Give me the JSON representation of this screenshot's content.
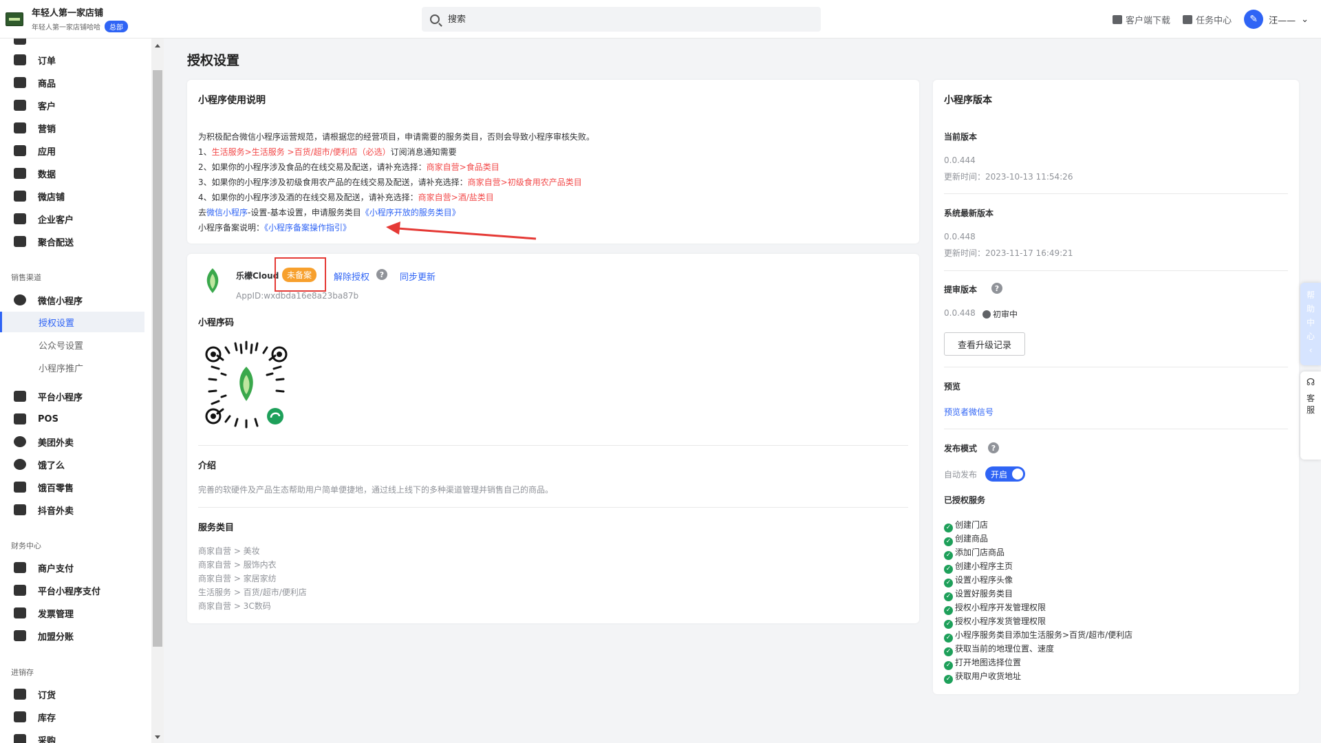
{
  "header": {
    "store_name": "年轻人第一家店铺",
    "store_sub": "年轻人第一家店铺哈哈",
    "store_badge": "总部",
    "search_placeholder": "搜索",
    "download_label": "客户端下载",
    "task_label": "任务中心",
    "user_name": "汪——"
  },
  "sidebar": {
    "items_top": [
      {
        "label": "订单"
      },
      {
        "label": "商品"
      },
      {
        "label": "客户"
      },
      {
        "label": "营销"
      },
      {
        "label": "应用"
      },
      {
        "label": "数据"
      },
      {
        "label": "微店铺"
      },
      {
        "label": "企业客户"
      },
      {
        "label": "聚合配送"
      }
    ],
    "group_sales": "销售渠道",
    "wechat_mini": "微信小程序",
    "sub_items": [
      {
        "label": "授权设置"
      },
      {
        "label": "公众号设置"
      },
      {
        "label": "小程序推广"
      }
    ],
    "items_sales": [
      {
        "label": "平台小程序"
      },
      {
        "label": "POS"
      },
      {
        "label": "美团外卖"
      },
      {
        "label": "饿了么"
      },
      {
        "label": "饿百零售"
      },
      {
        "label": "抖音外卖"
      }
    ],
    "group_finance": "财务中心",
    "items_finance": [
      {
        "label": "商户支付"
      },
      {
        "label": "平台小程序支付"
      },
      {
        "label": "发票管理"
      },
      {
        "label": "加盟分账"
      }
    ],
    "group_inventory": "进销存",
    "items_inventory": [
      {
        "label": "订货"
      },
      {
        "label": "库存"
      },
      {
        "label": "采购"
      }
    ]
  },
  "page": {
    "title": "授权设置"
  },
  "usage": {
    "title": "小程序使用说明",
    "intro": "为积极配合微信小程序运营规范，请根据您的经营项目，申请需要的服务类目，否则会导致小程序审核失败。",
    "line1_prefix": "1、",
    "line1_red": "生活服务>生活服务 >百货/超市/便利店（必选）",
    "line1_suffix": "订阅消息通知需要",
    "line2_prefix": "2、如果你的小程序涉及食品的在线交易及配送，请补充选择：",
    "line2_red": "商家自营>食品类目",
    "line3_prefix": "3、如果你的小程序涉及初级食用农产品的在线交易及配送，请补充选择：",
    "line3_red": "商家自营>初级食用农产品类目",
    "line4_prefix": "4、如果你的小程序涉及酒的在线交易及配送，请补充选择：",
    "line4_red": "商家自营>酒/盐类目",
    "line5_prefix": "去",
    "line5_link1": "微信小程序",
    "line5_mid": "-设置-基本设置，申请服务类目",
    "line5_link2": "《小程序开放的服务类目》",
    "line6_prefix": "小程序备案说明：",
    "line6_link": "《小程序备案操作指引》"
  },
  "mini": {
    "name": "乐檬Cloud",
    "status_tag": "未备案",
    "unauth_label": "解除授权",
    "sync_label": "同步更新",
    "appid": "AppID:wxdbda16e8a23ba87b",
    "code_title": "小程序码",
    "intro_title": "介绍",
    "intro_text": "完善的软硬件及产品生态帮助用户简单便捷地，通过线上线下的多种渠道管理并销售自己的商品。",
    "category_title": "服务类目",
    "categories": [
      {
        "label": "商家自营 > 美妆"
      },
      {
        "label": "商家自营 > 服饰内衣"
      },
      {
        "label": "商家自营 > 家居家纺"
      },
      {
        "label": "生活服务 > 百货/超市/便利店"
      },
      {
        "label": "商家自营 > 3C数码"
      }
    ]
  },
  "version": {
    "title": "小程序版本",
    "current_title": "当前版本",
    "current_version": "0.0.444",
    "current_time": "更新时间：2023-10-13 11:54:26",
    "latest_title": "系统最新版本",
    "latest_version": "0.0.448",
    "latest_time": "更新时间：2023-11-17 16:49:21",
    "review_title": "提审版本",
    "review_version": "0.0.448",
    "review_status": "初审中",
    "history_button": "查看升级记录",
    "preview_title": "预览",
    "preview_link": "预览者微信号",
    "publish_title": "发布模式",
    "auto_publish_label": "自动发布",
    "switch_label": "开启",
    "services_title": "已授权服务",
    "services": [
      {
        "label": "创建门店"
      },
      {
        "label": "创建商品"
      },
      {
        "label": "添加门店商品"
      },
      {
        "label": "创建小程序主页"
      },
      {
        "label": "设置小程序头像"
      },
      {
        "label": "设置好服务类目"
      },
      {
        "label": "授权小程序开发管理权限"
      },
      {
        "label": "授权小程序发货管理权限"
      },
      {
        "label": "小程序服务类目添加生活服务>百货/超市/便利店"
      },
      {
        "label": "获取当前的地理位置、速度"
      },
      {
        "label": "打开地图选择位置"
      },
      {
        "label": "获取用户收货地址"
      }
    ]
  },
  "floating": {
    "help_chars": [
      "帮",
      "助",
      "中",
      "心"
    ],
    "cs_chars": [
      "客",
      "服"
    ]
  },
  "colors": {
    "primary": "#2f64f5",
    "danger": "#f24848",
    "warning": "#f7a02d",
    "success": "#1ea05a"
  }
}
